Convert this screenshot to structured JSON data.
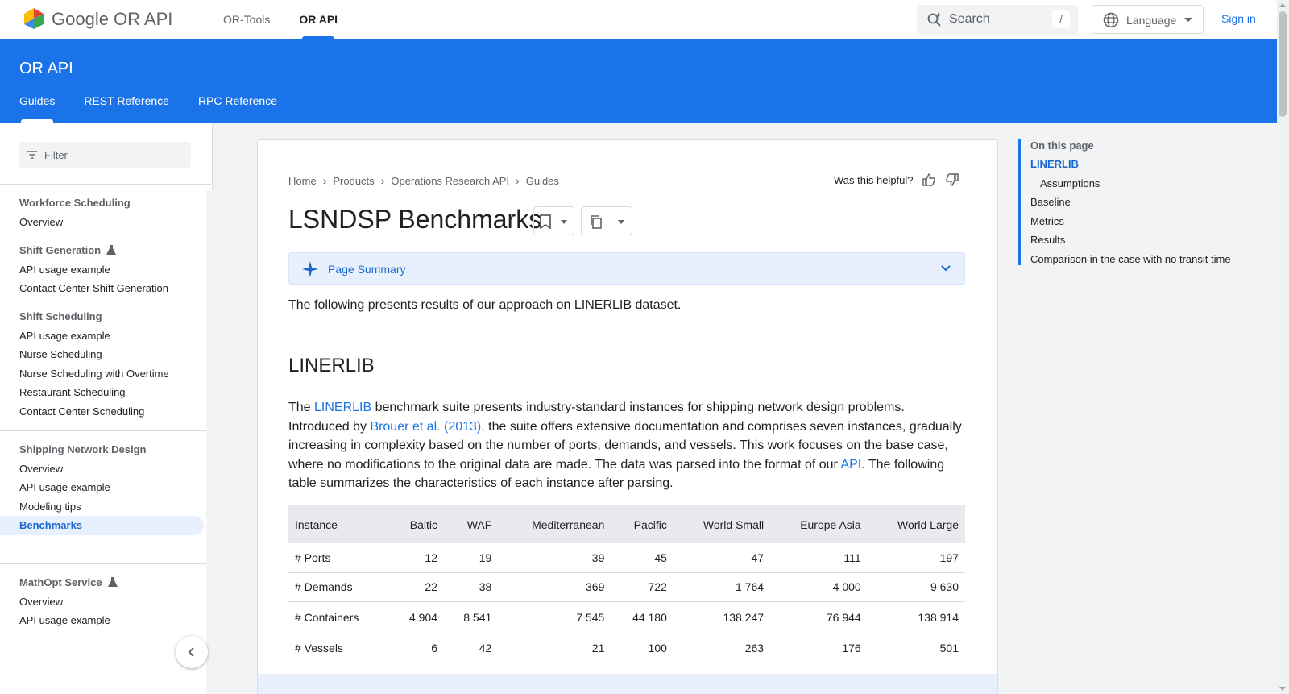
{
  "header": {
    "brand": "Google OR API",
    "nav": [
      "OR-Tools",
      "OR API"
    ],
    "search_placeholder": "Search",
    "search_shortcut": "/",
    "language": "Language",
    "sign_in": "Sign in"
  },
  "band": {
    "title": "OR API",
    "tabs": [
      "Guides",
      "REST Reference",
      "RPC Reference"
    ]
  },
  "sidebar": {
    "filter_placeholder": "Filter",
    "sections": [
      {
        "head": "Workforce Scheduling",
        "items": [
          "Overview"
        ]
      },
      {
        "head": "Shift Generation",
        "items": [
          "API usage example",
          "Contact Center Shift Generation"
        ]
      },
      {
        "head": "Shift Scheduling",
        "items": [
          "API usage example",
          "Nurse Scheduling",
          "Nurse Scheduling with Overtime",
          "Restaurant Scheduling",
          "Contact Center Scheduling"
        ]
      },
      {
        "head": "Shipping Network Design",
        "items": [
          "Overview",
          "API usage example",
          "Modeling tips",
          "Benchmarks"
        ]
      },
      {
        "head": "MathOpt Service",
        "items": [
          "Overview",
          "API usage example"
        ]
      }
    ]
  },
  "breadcrumb": [
    "Home",
    "Products",
    "Operations Research API",
    "Guides"
  ],
  "helpful": "Was this helpful?",
  "page_title": "LSNDSP Benchmarks",
  "summary_label": "Page Summary",
  "intro": "The following presents results of our approach on LINERLIB dataset.",
  "section_title": "LINERLIB",
  "paragraph": {
    "p1": "The ",
    "link1": "LINERLIB",
    "p2": " benchmark suite presents industry-standard instances for shipping network design problems. Introduced by ",
    "link2": "Brouer et al. (2013)",
    "p3": ", the suite offers extensive documentation and comprises seven instances, gradually increasing in complexity based on the number of ports, demands, and vessels. This work focuses on the base case, where no modifications to the original data are made. The data was parsed into the format of our ",
    "link3": "API",
    "p4": ". The following table summarizes the characteristics of each instance after parsing."
  },
  "table": {
    "headers": [
      "Instance",
      "Baltic",
      "WAF",
      "Mediterranean",
      "Pacific",
      "World Small",
      "Europe Asia",
      "World Large"
    ],
    "rows": [
      [
        "# Ports",
        "12",
        "19",
        "39",
        "45",
        "47",
        "111",
        "197"
      ],
      [
        "# Demands",
        "22",
        "38",
        "369",
        "722",
        "1 764",
        "4 000",
        "9 630"
      ],
      [
        "# Containers",
        "4 904",
        "8 541",
        "7 545",
        "44 180",
        "138 247",
        "76 944",
        "138 914"
      ],
      [
        "# Vessels",
        "6",
        "42",
        "21",
        "100",
        "263",
        "176",
        "501"
      ]
    ]
  },
  "toc": {
    "head": "On this page",
    "items": [
      "LINERLIB",
      "Assumptions",
      "Baseline",
      "Metrics",
      "Results",
      "Comparison in the case with no transit time"
    ]
  },
  "colors": {
    "accent": "#1a73e8",
    "active_bg": "#e8f0fe"
  }
}
